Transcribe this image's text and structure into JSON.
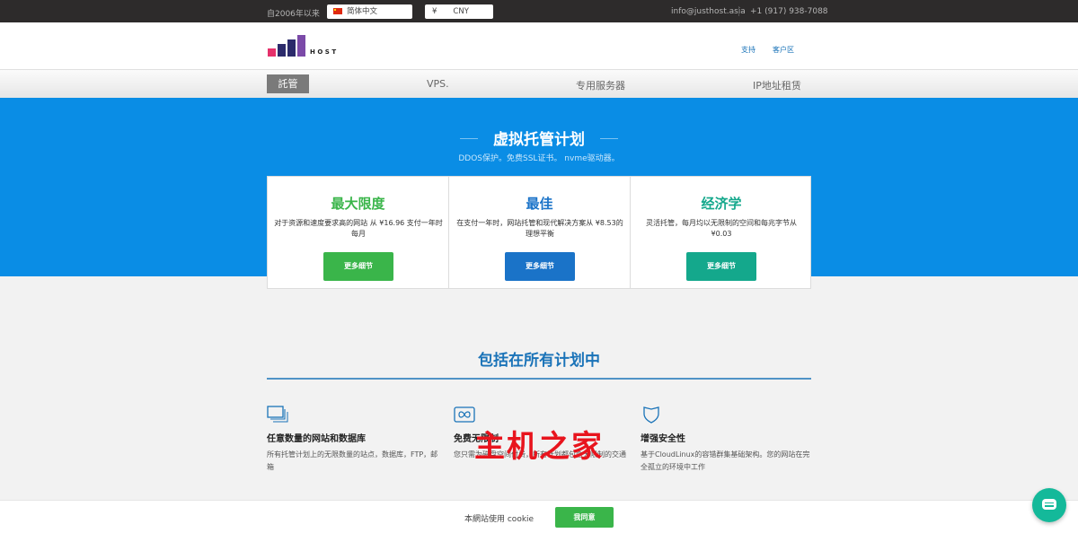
{
  "topbar": {
    "since": "自2006年以来",
    "language": "简体中文",
    "currency_symbol": "¥",
    "currency": "CNY",
    "email": "info@justhost.asia",
    "phone": "+1 (917) 938-7088"
  },
  "header": {
    "logo_letters": [
      "J",
      "U",
      "S",
      "T"
    ],
    "logo_word": "HOST",
    "links": [
      "支持",
      "客户区"
    ]
  },
  "nav": {
    "items": [
      "託管",
      "VPS.",
      "专用服务器",
      "IP地址租赁"
    ]
  },
  "hero": {
    "title": "虚拟托管计划",
    "subtitle": "DDOS保护。免费SSL证书。 nvme驱动器。"
  },
  "plans": [
    {
      "name": "最大限度",
      "desc": "对于资源和速度要求高的网站 从 ¥16.96 支付一年时每月",
      "button": "更多细节",
      "color": "#3ab54a"
    },
    {
      "name": "最佳",
      "desc": "在支付一年时，网站托管和现代解决方案从 ¥8.53的理想平衡",
      "button": "更多细节",
      "color": "#1a73c8"
    },
    {
      "name": "经济学",
      "desc": "灵活托管，每月均以无限制的空间和每兆字节从 ¥0.03",
      "button": "更多细节",
      "color": "#14a88c"
    }
  ],
  "features": {
    "title": "包括在所有计划中",
    "items": [
      {
        "icon": "stacked-windows-icon",
        "title": "任意数量的网站和数据库",
        "desc": "所有托管计划上的无限数量的站点，数据库，FTP，邮箱"
      },
      {
        "icon": "infinity-icon",
        "title": "免费无限制",
        "desc": "您只需为磁盘空间付费，所有计划都包含无限制的交通"
      },
      {
        "icon": "shield-icon",
        "title": "增强安全性",
        "desc": "基于CloudLinux的容错群集基础架构。您的网站在完全孤立的环境中工作"
      }
    ]
  },
  "watermark": "主机之家",
  "cookie": {
    "text": "本網站使用 cookie",
    "button": "我同意"
  },
  "colors": {
    "hero_blue": "#0a8de5",
    "link_blue": "#1a73b8",
    "green": "#3ab54a"
  }
}
